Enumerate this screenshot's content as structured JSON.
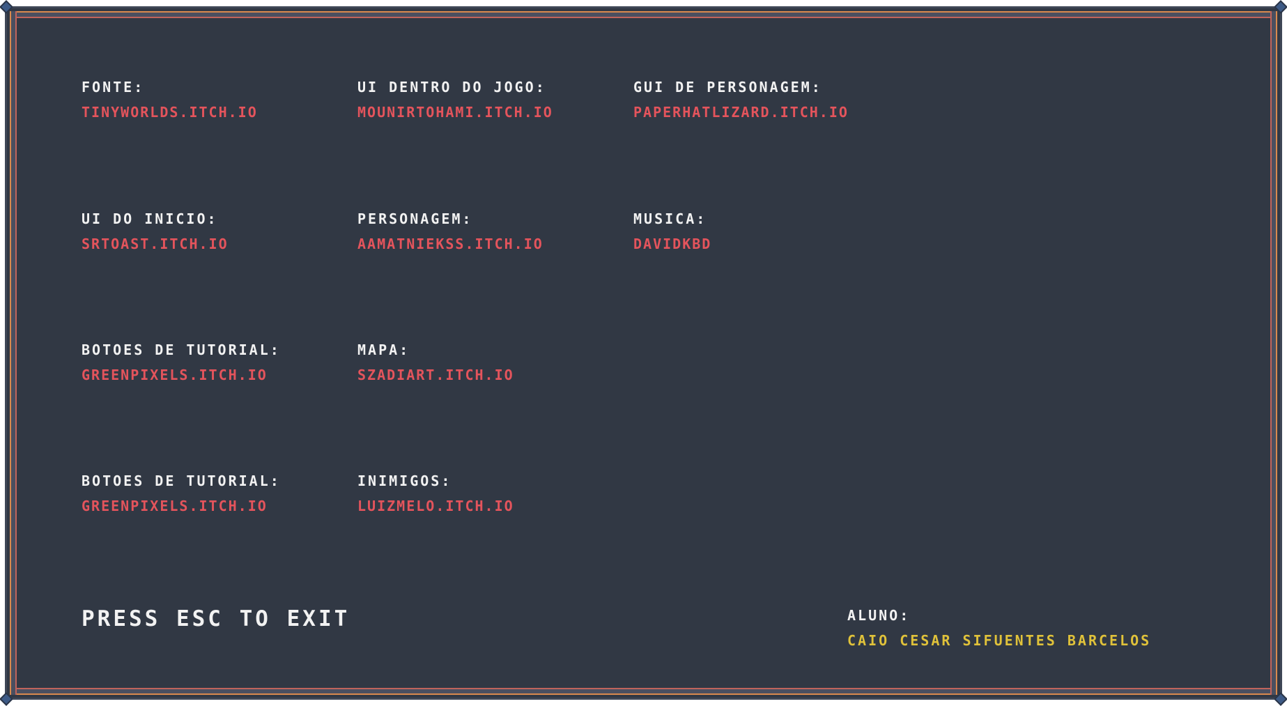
{
  "credits": [
    {
      "label": "FONTE:",
      "value": "TINYWORLDS.ITCH.IO"
    },
    {
      "label": "UI DENTRO DO JOGO:",
      "value": "MOUNIRTOHAMI.ITCH.IO"
    },
    {
      "label": "GUI DE PERSONAGEM:",
      "value": "PAPERHATLIZARD.ITCH.IO"
    },
    {
      "label": "UI DO INICIO:",
      "value": "SRTOAST.ITCH.IO"
    },
    {
      "label": "PERSONAGEM:",
      "value": "AAMATNIEKSS.ITCH.IO"
    },
    {
      "label": "MUSICA:",
      "value": "DAVIDKBD"
    },
    {
      "label": "BOTOES DE TUTORIAL:",
      "value": "GREENPIXELS.ITCH.IO"
    },
    {
      "label": "MAPA:",
      "value": "SZADIART.ITCH.IO"
    },
    {
      "label": "BOTOES DE TUTORIAL:",
      "value": "GREENPIXELS.ITCH.IO"
    },
    {
      "label": "INIMIGOS:",
      "value": "LUIZMELO.ITCH.IO"
    }
  ],
  "student": {
    "label": "ALUNO:",
    "name": "CAIO CESAR SIFUENTES BARCELOS"
  },
  "exit_hint": "PRESS ESC TO EXIT",
  "colors": {
    "background": "#313844",
    "label": "#f2f2f2",
    "link": "#e4545c",
    "student_name": "#e0c23a",
    "frame_outer": "#d98a4e",
    "frame_inner": "#c0645c"
  }
}
